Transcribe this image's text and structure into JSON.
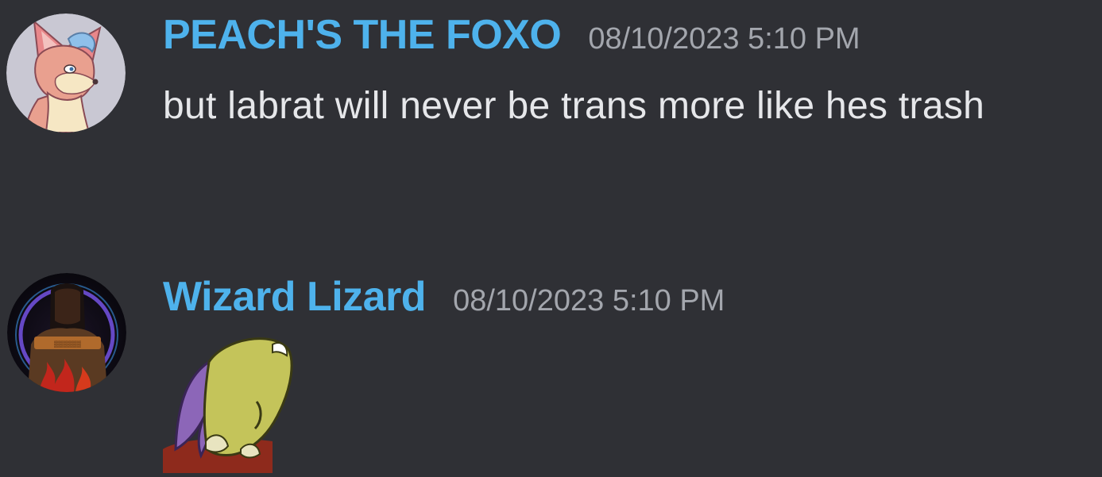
{
  "colors": {
    "background": "#2f3035",
    "username": "#4eb2ec",
    "timestamp": "#a3a6ad",
    "message_text": "#e6e7ea"
  },
  "messages": [
    {
      "author": "PEACH'S THE FOXO",
      "timestamp": "08/10/2023 5:10 PM",
      "avatar": "fox-avatar",
      "text": "but labrat will never be trans more like hes trash"
    },
    {
      "author": "Wizard Lizard",
      "timestamp": "08/10/2023 5:10 PM",
      "avatar": "hooded-figure-avatar",
      "sticker": "creature-emoji"
    }
  ]
}
